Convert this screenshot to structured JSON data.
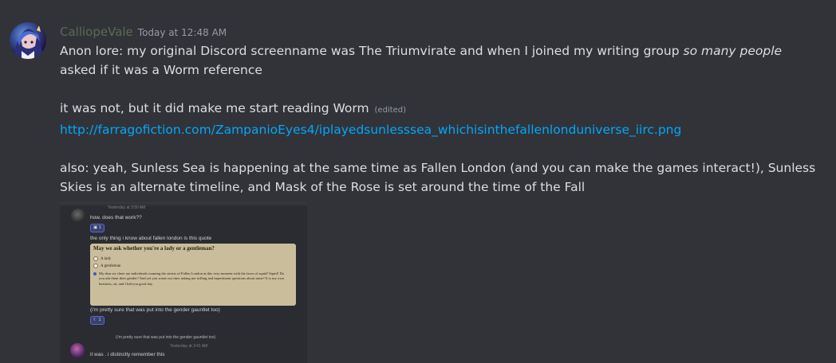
{
  "message": {
    "username": "CalliopeVale",
    "timestamp": "Today at 12:48 AM",
    "line1_pre": "Anon lore: my original Discord screenname was The Triumvirate and when I joined my writing group ",
    "line1_emph": "so many people",
    "line1_post": " asked if it was a Worm reference",
    "line2": "it was not, but it did make me start reading Worm",
    "edited_label": "(edited)",
    "link": "http://farragofiction.com/ZampanioEyes4/iplayedsunlesssea_whichisinthefallenlonduniverse_iirc.png",
    "line3": "also: yeah, Sunless Sea is happening at the same time as Fallen London (and you can make the games interact!), Sunless Skies is an alternate timeline, and Mask of the Rose is set around the time of the Fall"
  },
  "embed": {
    "top_meta": "Yesterday at 3:50 AM",
    "msg1": "how. does that work??",
    "reaction1": "1",
    "msg2": "the only thing i know about fallen london is this quote",
    "quiz_title": "May we ask whether you're a lady or a gentleman?",
    "quiz_opt1": "A lady",
    "quiz_opt2": "A gentleman",
    "quiz_opt3": "My dear sir, there are individuals roaming the streets of Fallen London at this very moment with the faces of squid! Squid! Do you ask them their gender? And yet you waste our time asking me trifling and impertinent questions about mine? It is my own business, sir, and I bid you good day.",
    "msg3": "(i'm pretty sure that was put into the gender gauntlet too)",
    "reaction2": "1",
    "reply_preview": "(i'm pretty sure that was put into the gender gauntlet too)",
    "reply_meta": "Yesterday at 3:41 AM",
    "msg4": "it was . i distinctly remember this"
  },
  "colors": {
    "background": "#323339",
    "username": "#5b6b50",
    "link": "#00a8fc",
    "text": "#dbdee1",
    "muted": "#949ba4"
  }
}
